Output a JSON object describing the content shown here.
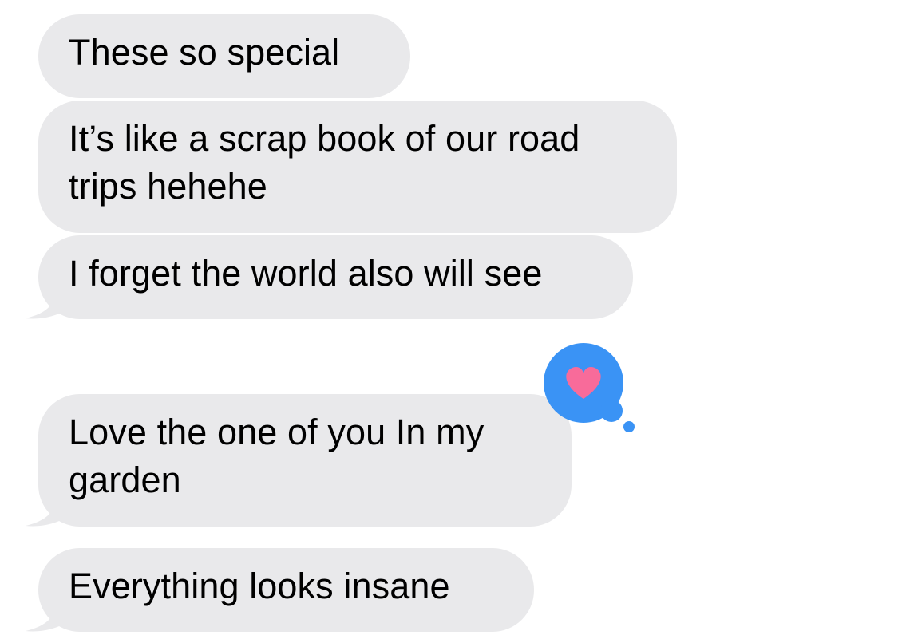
{
  "conversation": {
    "messages": [
      {
        "lines": [
          "These so special"
        ]
      },
      {
        "lines": [
          "It’s like a scrap book of our road",
          "trips hehehe"
        ]
      },
      {
        "lines": [
          "I forget the world also will see"
        ]
      },
      {
        "lines": [
          "Love the one of you In my",
          "garden"
        ],
        "reaction": "heart-icon"
      },
      {
        "lines": [
          "Everything looks insane"
        ]
      }
    ]
  },
  "colors": {
    "incoming_bubble": "#e9e9eb",
    "incoming_text": "#000000",
    "reaction_bubble": "#3a93f5",
    "reaction_heart": "#f86b9a",
    "background": "#ffffff"
  }
}
